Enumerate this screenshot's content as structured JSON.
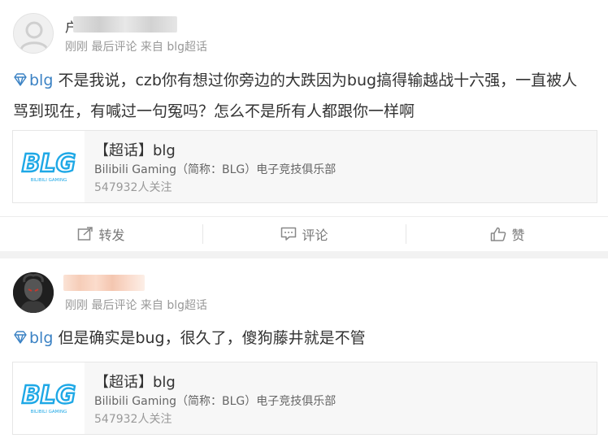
{
  "posts": [
    {
      "author": "户",
      "meta": "刚刚 最后评论 来自 blg超话",
      "topic": "blg",
      "text": " 不是我说，czb你有想过你旁边的大跌因为bug搞得输越战十六强，一直被人骂到现在，有喊过一句冤吗？怎么不是所有人都跟你一样啊",
      "card": {
        "logo_text": "BLG",
        "logo_sub": "BILIBILI GAMING",
        "title": "【超话】blg",
        "desc": "Bilibili Gaming（简称：BLG）电子竞技俱乐部",
        "count": "547932人关注"
      }
    },
    {
      "author": "",
      "meta": "刚刚 最后评论 来自 blg超话",
      "topic": "blg",
      "text": " 但是确实是bug，很久了，傻狗藤井就是不管",
      "card": {
        "logo_text": "BLG",
        "logo_sub": "BILIBILI GAMING",
        "title": "【超话】blg",
        "desc": "Bilibili Gaming（简称：BLG）电子竞技俱乐部",
        "count": "547932人关注"
      }
    }
  ],
  "actions": {
    "repost": "转发",
    "comment": "评论",
    "like": "赞"
  },
  "colors": {
    "topic_link": "#3b82c4",
    "logo_blue": "#1ea8e6",
    "meta_gray": "#999999"
  }
}
